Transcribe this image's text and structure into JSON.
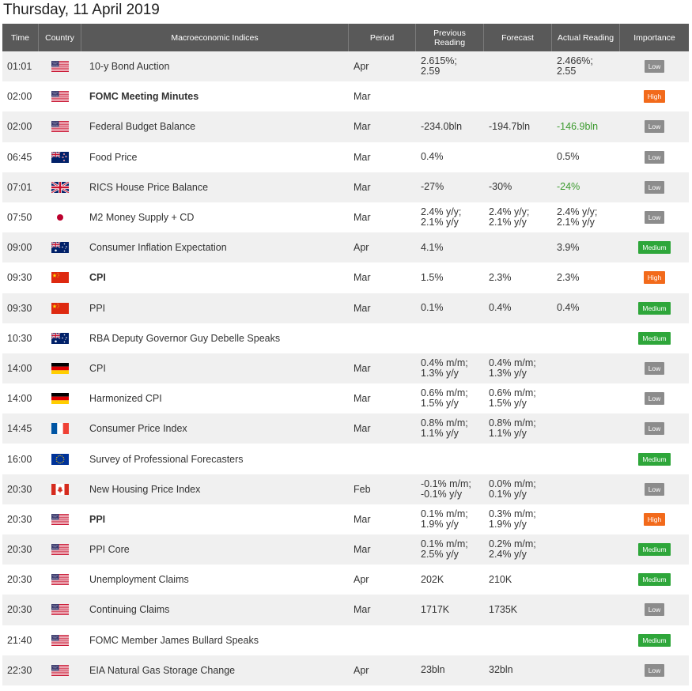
{
  "title": "Thursday, 11 April 2019",
  "headers": {
    "time": "Time",
    "country": "Country",
    "name": "Macroeconomic Indices",
    "period": "Period",
    "previous_line1": "Previous",
    "previous_line2": "Reading",
    "forecast": "Forecast",
    "actual": "Actual Reading",
    "importance": "Importance"
  },
  "colors": {
    "header_bg": "#595959",
    "row_alt_bg": "#f0f0f0",
    "positive_text": "#3b9a2e",
    "badge_low": "#8c8c8c",
    "badge_medium": "#2ea63a",
    "badge_high": "#f26a1b"
  },
  "rows": [
    {
      "time": "01:01",
      "flag": "us-flag",
      "name": "10-y Bond Auction",
      "bold": false,
      "period": "Apr",
      "prev": [
        "2.615%;",
        "2.59"
      ],
      "fore": [],
      "act": [
        "2.466%;",
        "2.55"
      ],
      "act_green": false,
      "importance": "Low"
    },
    {
      "time": "02:00",
      "flag": "us-flag",
      "name": "FOMC Meeting Minutes",
      "bold": true,
      "period": "Mar",
      "prev": [],
      "fore": [],
      "act": [],
      "act_green": false,
      "importance": "High"
    },
    {
      "time": "02:00",
      "flag": "us-flag",
      "name": "Federal Budget Balance",
      "bold": false,
      "period": "Mar",
      "prev": [
        "-234.0bln"
      ],
      "fore": [
        "-194.7bln"
      ],
      "act": [
        "-146.9bln"
      ],
      "act_green": true,
      "importance": "Low"
    },
    {
      "time": "06:45",
      "flag": "nz-flag",
      "name": "Food Price",
      "bold": false,
      "period": "Mar",
      "prev": [
        "0.4%"
      ],
      "fore": [],
      "act": [
        "0.5%"
      ],
      "act_green": false,
      "importance": "Low"
    },
    {
      "time": "07:01",
      "flag": "uk-flag",
      "name": "RICS House Price Balance",
      "bold": false,
      "period": "Mar",
      "prev": [
        "-27%"
      ],
      "fore": [
        "-30%"
      ],
      "act": [
        "-24%"
      ],
      "act_green": true,
      "importance": "Low"
    },
    {
      "time": "07:50",
      "flag": "jp-flag",
      "name": "M2 Money Supply + CD",
      "bold": false,
      "period": "Mar",
      "prev": [
        "2.4% y/y;",
        "2.1% y/y"
      ],
      "fore": [
        "2.4% y/y;",
        "2.1% y/y"
      ],
      "act": [
        "2.4% y/y;",
        "2.1% y/y"
      ],
      "act_green": false,
      "importance": "Low"
    },
    {
      "time": "09:00",
      "flag": "au-flag",
      "name": "Consumer Inflation Expectation",
      "bold": false,
      "period": "Apr",
      "prev": [
        "4.1%"
      ],
      "fore": [],
      "act": [
        "3.9%"
      ],
      "act_green": false,
      "importance": "Medium"
    },
    {
      "time": "09:30",
      "flag": "cn-flag",
      "name": "CPI",
      "bold": true,
      "period": "Mar",
      "prev": [
        "1.5%"
      ],
      "fore": [
        "2.3%"
      ],
      "act": [
        "2.3%"
      ],
      "act_green": false,
      "importance": "High"
    },
    {
      "time": "09:30",
      "flag": "cn-flag",
      "name": "PPI",
      "bold": false,
      "period": "Mar",
      "prev": [
        "0.1%"
      ],
      "fore": [
        "0.4%"
      ],
      "act": [
        "0.4%"
      ],
      "act_green": false,
      "importance": "Medium"
    },
    {
      "time": "10:30",
      "flag": "au-flag",
      "name": "RBA Deputy Governor Guy Debelle Speaks",
      "bold": false,
      "period": "",
      "prev": [],
      "fore": [],
      "act": [],
      "act_green": false,
      "importance": "Medium"
    },
    {
      "time": "14:00",
      "flag": "de-flag",
      "name": "CPI",
      "bold": false,
      "period": "Mar",
      "prev": [
        "0.4% m/m;",
        "1.3% y/y"
      ],
      "fore": [
        "0.4% m/m;",
        "1.3% y/y"
      ],
      "act": [],
      "act_green": false,
      "importance": "Low"
    },
    {
      "time": "14:00",
      "flag": "de-flag",
      "name": "Harmonized CPI",
      "bold": false,
      "period": "Mar",
      "prev": [
        "0.6% m/m;",
        "1.5% y/y"
      ],
      "fore": [
        "0.6% m/m;",
        "1.5% y/y"
      ],
      "act": [],
      "act_green": false,
      "importance": "Low"
    },
    {
      "time": "14:45",
      "flag": "fr-flag",
      "name": "Consumer Price Index",
      "bold": false,
      "period": "Mar",
      "prev": [
        "0.8% m/m;",
        "1.1% y/y"
      ],
      "fore": [
        "0.8% m/m;",
        "1.1% y/y"
      ],
      "act": [],
      "act_green": false,
      "importance": "Low"
    },
    {
      "time": "16:00",
      "flag": "eu-flag",
      "name": "Survey of Professional Forecasters",
      "bold": false,
      "period": "",
      "prev": [],
      "fore": [],
      "act": [],
      "act_green": false,
      "importance": "Medium"
    },
    {
      "time": "20:30",
      "flag": "ca-flag",
      "name": "New Housing Price Index",
      "bold": false,
      "period": "Feb",
      "prev": [
        "-0.1% m/m;",
        "-0.1% y/y"
      ],
      "fore": [
        "0.0% m/m;",
        "0.1% y/y"
      ],
      "act": [],
      "act_green": false,
      "importance": "Low"
    },
    {
      "time": "20:30",
      "flag": "us-flag",
      "name": "PPI",
      "bold": true,
      "period": "Mar",
      "prev": [
        "0.1% m/m;",
        "1.9% y/y"
      ],
      "fore": [
        "0.3% m/m;",
        "1.9% y/y"
      ],
      "act": [],
      "act_green": false,
      "importance": "High"
    },
    {
      "time": "20:30",
      "flag": "us-flag",
      "name": "PPI Core",
      "bold": false,
      "period": "Mar",
      "prev": [
        "0.1% m/m;",
        "2.5% y/y"
      ],
      "fore": [
        "0.2% m/m;",
        "2.4% y/y"
      ],
      "act": [],
      "act_green": false,
      "importance": "Medium"
    },
    {
      "time": "20:30",
      "flag": "us-flag",
      "name": "Unemployment Claims",
      "bold": false,
      "period": "Apr",
      "prev": [
        "202K"
      ],
      "fore": [
        "210K"
      ],
      "act": [],
      "act_green": false,
      "importance": "Medium"
    },
    {
      "time": "20:30",
      "flag": "us-flag",
      "name": "Continuing Claims",
      "bold": false,
      "period": "Mar",
      "prev": [
        "1717K"
      ],
      "fore": [
        "1735K"
      ],
      "act": [],
      "act_green": false,
      "importance": "Low"
    },
    {
      "time": "21:40",
      "flag": "us-flag",
      "name": "FOMC Member James Bullard Speaks",
      "bold": false,
      "period": "",
      "prev": [],
      "fore": [],
      "act": [],
      "act_green": false,
      "importance": "Medium"
    },
    {
      "time": "22:30",
      "flag": "us-flag",
      "name": "EIA Natural Gas Storage Change",
      "bold": false,
      "period": "Apr",
      "prev": [
        "23bln"
      ],
      "fore": [
        "32bln"
      ],
      "act": [],
      "act_green": false,
      "importance": "Low"
    }
  ]
}
